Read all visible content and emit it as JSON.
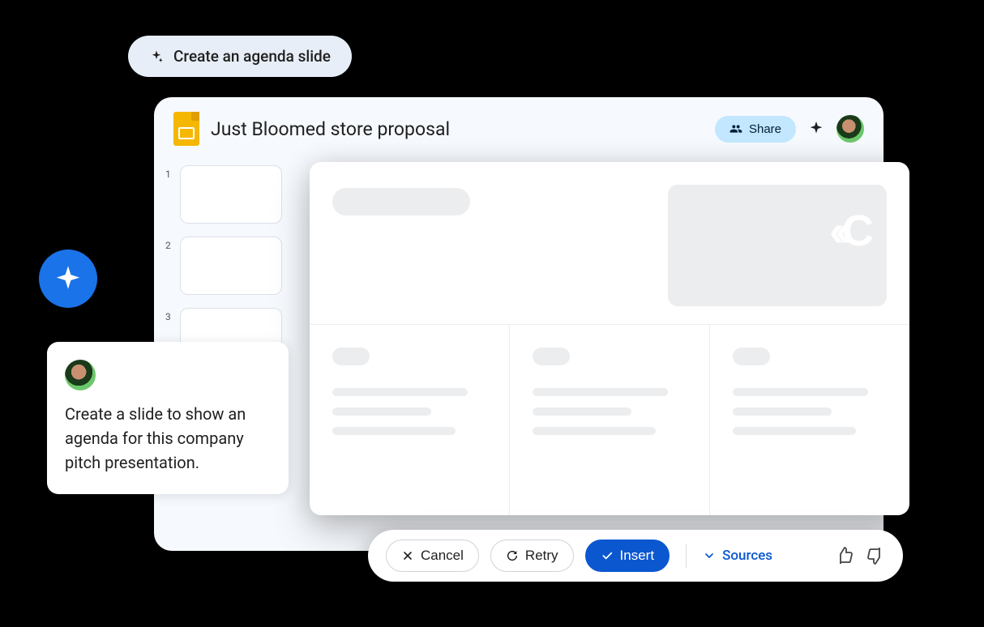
{
  "suggestion": {
    "label": "Create an agenda slide"
  },
  "header": {
    "title": "Just Bloomed store proposal",
    "share_label": "Share"
  },
  "thumbnails": {
    "numbers": [
      "1",
      "2",
      "3"
    ]
  },
  "prompt": {
    "text": "Create a slide to show an agenda for this company pitch presentation."
  },
  "actions": {
    "cancel": "Cancel",
    "retry": "Retry",
    "insert": "Insert",
    "sources": "Sources"
  }
}
